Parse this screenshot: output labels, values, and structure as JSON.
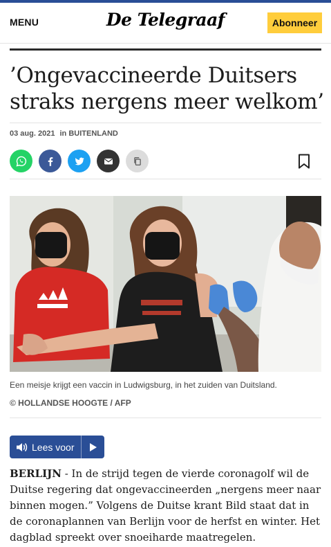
{
  "header": {
    "menu_label": "MENU",
    "logo_text": "De Telegraaf",
    "subscribe_label": "Abonneer"
  },
  "article": {
    "headline": "’Ongevaccineerde Duitsers straks nergens meer welkom’",
    "date": "03 aug. 2021",
    "in_label": "in",
    "section": "BUITENLAND",
    "caption": "Een meisje krijgt een vaccin in Ludwigsburg, in het zuiden van Duitsland.",
    "credit": "© HOLLANDSE HOOGTE / AFP",
    "listen_label": "Lees voor",
    "body_lead": "BERLIJN",
    "body_text": " - In de strijd tegen de vierde coronagolf wil de Duitse regering dat ongevaccineerden „nergens meer naar binnen mogen.” Volgens de Duitse krant Bild staat dat in de coronaplannen van Berlijn voor de herfst en winter. Het dagblad spreekt over snoeiharde maatregelen."
  },
  "share": {
    "icons": [
      "whatsapp-icon",
      "facebook-icon",
      "twitter-icon",
      "email-icon",
      "copy-icon",
      "bookmark-icon"
    ],
    "colors": {
      "whatsapp": "#25d366",
      "facebook": "#3b5998",
      "twitter": "#1da1f2",
      "email": "#333333",
      "copy": "#dcdcdc"
    }
  },
  "colors": {
    "brand": "#2a4e96",
    "accent": "#ffcd3c"
  }
}
